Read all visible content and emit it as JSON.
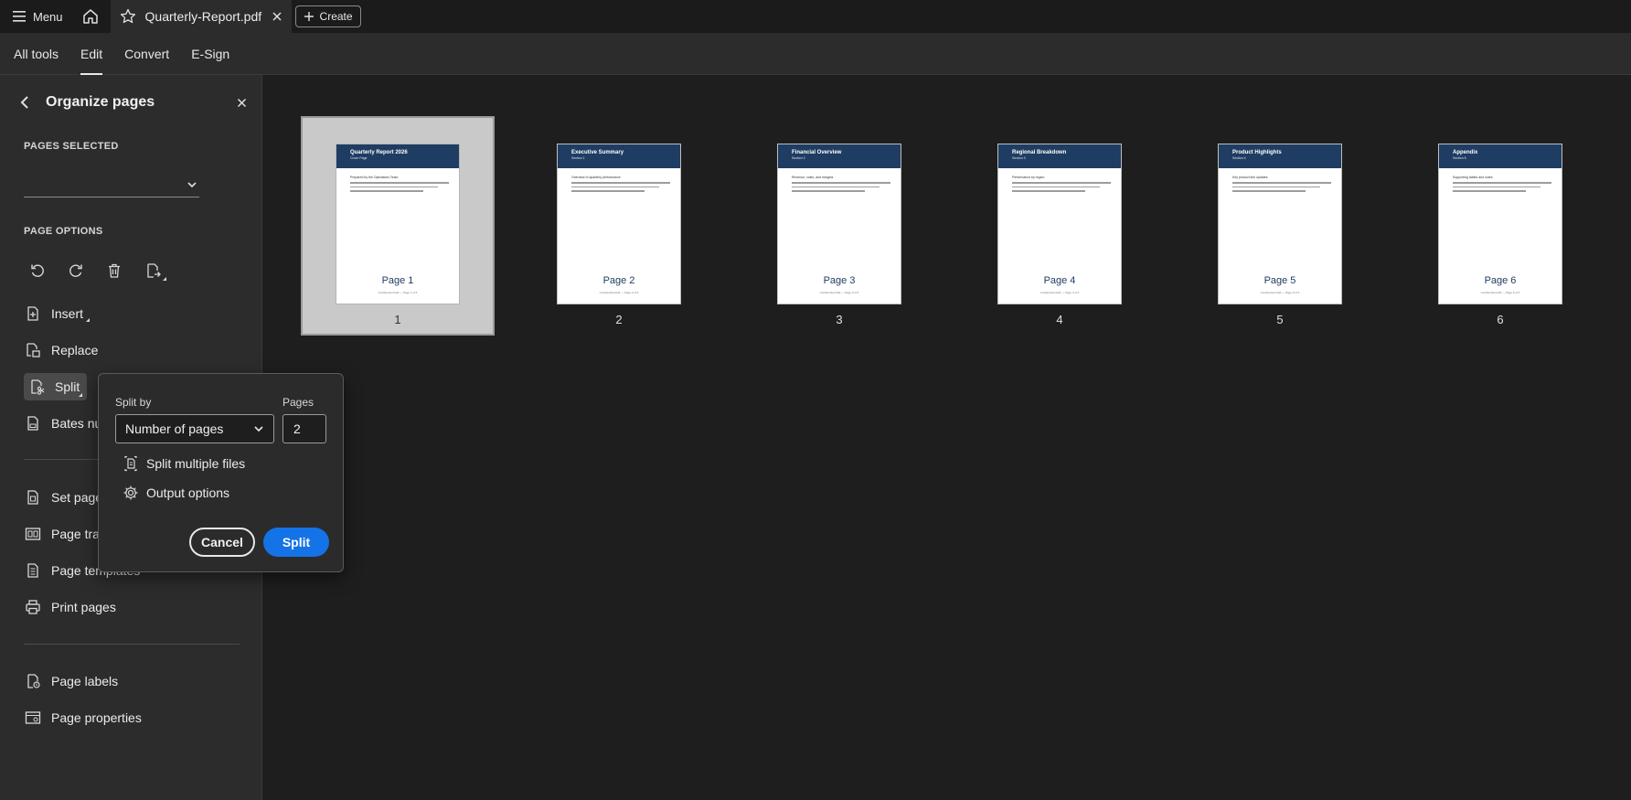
{
  "topbar": {
    "menu_label": "Menu",
    "tab_title": "Quarterly-Report.pdf",
    "create_label": "Create"
  },
  "toolbar": {
    "items": [
      {
        "label": "All tools",
        "active": false
      },
      {
        "label": "Edit",
        "active": true
      },
      {
        "label": "Convert",
        "active": false
      },
      {
        "label": "E-Sign",
        "active": false
      }
    ]
  },
  "sidebar": {
    "title": "Organize pages",
    "pages_selected_label": "PAGES SELECTED",
    "pages_selected_value": "",
    "page_options_label": "PAGE OPTIONS",
    "icons": [
      "rotate-left-icon",
      "rotate-right-icon",
      "delete-icon",
      "extract-icon"
    ],
    "items": {
      "insert": "Insert",
      "replace": "Replace",
      "split": "Split",
      "bates": "Bates nu",
      "set_page": "Set page",
      "page_transitions": "Page tran",
      "page_templates": "Page templates",
      "print_pages": "Print pages",
      "page_labels": "Page labels",
      "page_properties": "Page properties"
    }
  },
  "popover": {
    "split_by_label": "Split by",
    "pages_label": "Pages",
    "split_by_value": "Number of pages",
    "pages_value": "2",
    "split_multiple_files": "Split multiple files",
    "output_options": "Output options",
    "cancel_label": "Cancel",
    "split_label": "Split"
  },
  "pages": [
    {
      "heading": "Quarterly Report 2026",
      "sub": "Cover Page",
      "lead": "Prepared by the Operations Team",
      "big": "Page 1",
      "tiny": "Confidential draft — Page 1 of 6",
      "number": "1",
      "selected": true
    },
    {
      "heading": "Executive Summary",
      "sub": "Section 1",
      "lead": "Overview of quarterly performance",
      "big": "Page 2",
      "tiny": "Confidential draft — Page 2 of 6",
      "number": "2",
      "selected": false
    },
    {
      "heading": "Financial Overview",
      "sub": "Section 2",
      "lead": "Revenue, costs, and margins",
      "big": "Page 3",
      "tiny": "Confidential draft — Page 3 of 6",
      "number": "3",
      "selected": false
    },
    {
      "heading": "Regional Breakdown",
      "sub": "Section 3",
      "lead": "Performance by region",
      "big": "Page 4",
      "tiny": "Confidential draft — Page 4 of 6",
      "number": "4",
      "selected": false
    },
    {
      "heading": "Product Highlights",
      "sub": "Section 4",
      "lead": "Key product line updates",
      "big": "Page 5",
      "tiny": "Confidential draft — Page 5 of 6",
      "number": "5",
      "selected": false
    },
    {
      "heading": "Appendix",
      "sub": "Section 5",
      "lead": "Supporting tables and notes",
      "big": "Page 6",
      "tiny": "Confidential draft — Page 6 of 6",
      "number": "6",
      "selected": false
    }
  ]
}
